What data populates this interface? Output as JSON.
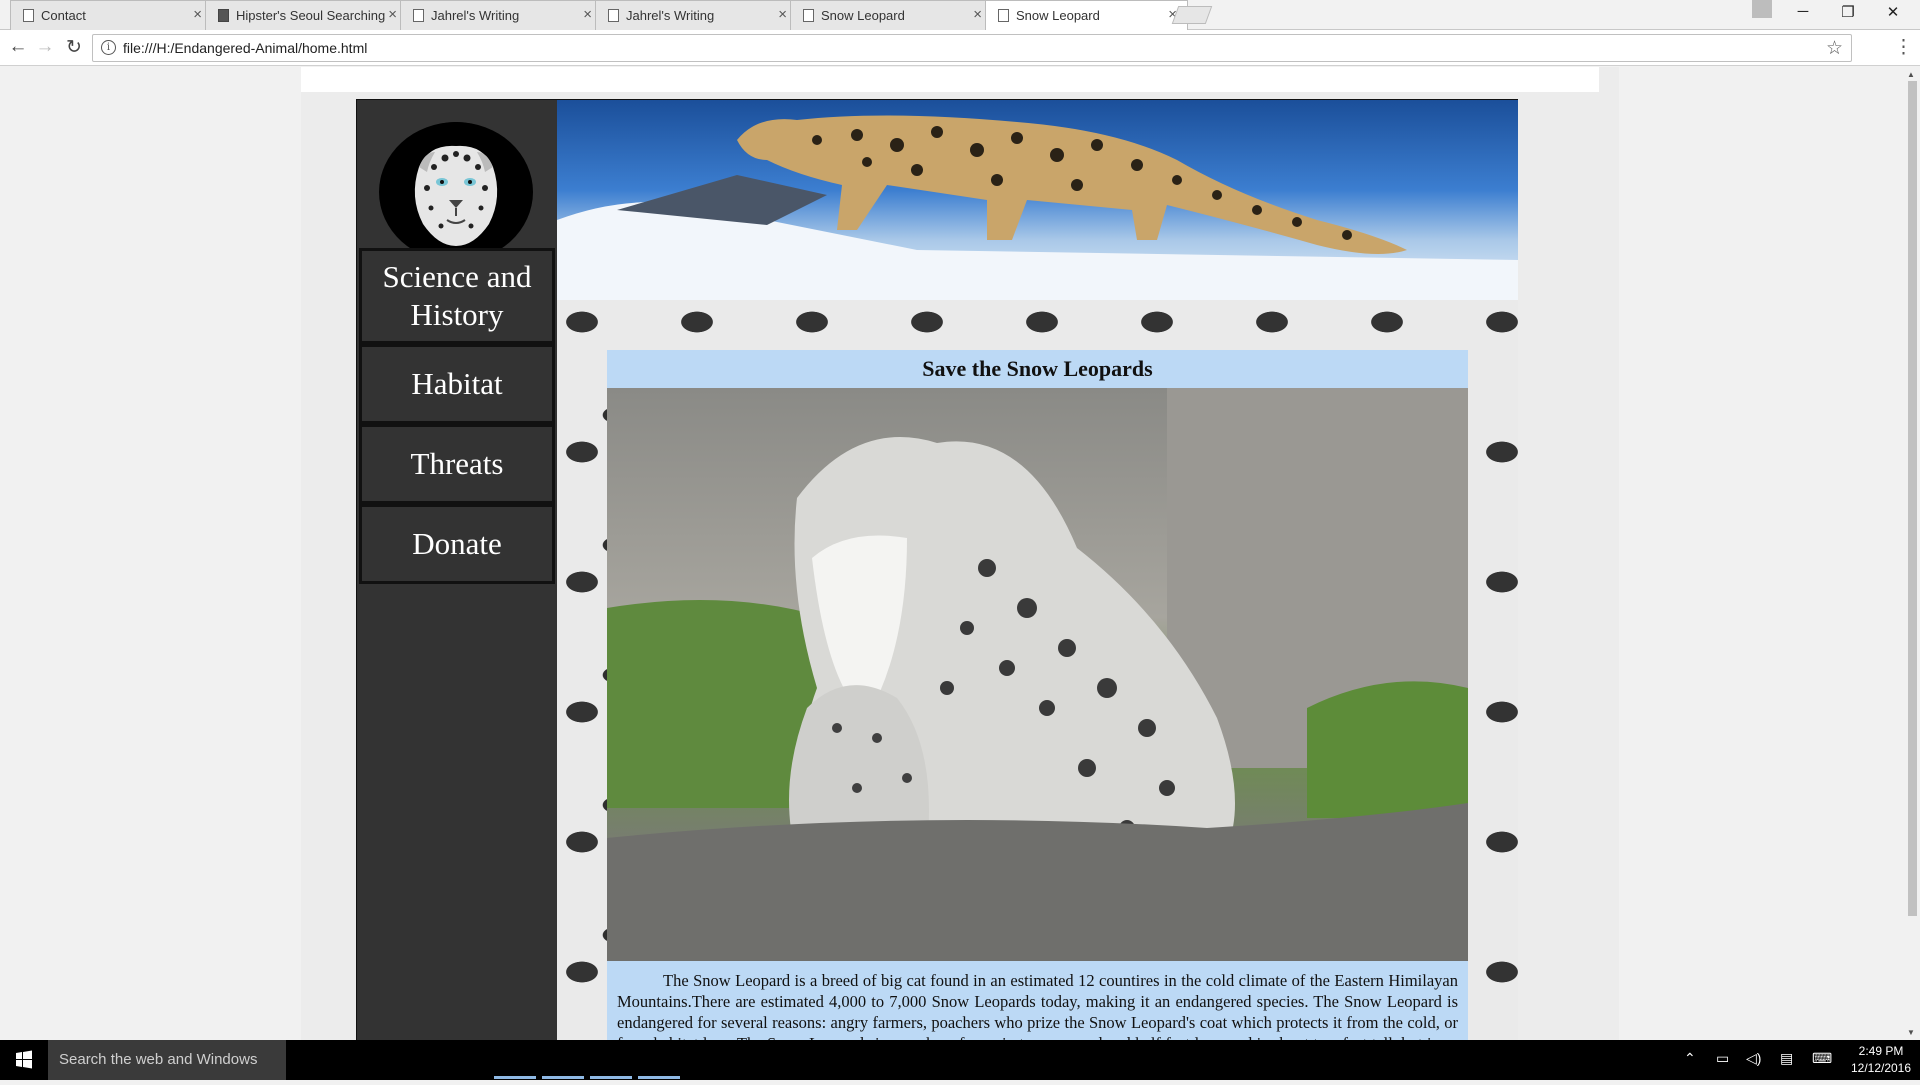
{
  "browser": {
    "tabs": [
      {
        "title": "Contact",
        "favicon": "page-icon"
      },
      {
        "title": "Hipster's Seoul Searching",
        "favicon": "bookmark-icon"
      },
      {
        "title": "Jahrel's Writing",
        "favicon": "page-icon"
      },
      {
        "title": "Jahrel's Writing",
        "favicon": "page-icon"
      },
      {
        "title": "Snow Leopard",
        "favicon": "page-icon"
      },
      {
        "title": "Snow Leopard",
        "favicon": "page-icon",
        "active": true
      }
    ],
    "tab_close_glyph": "×",
    "address": "file:///H:/Endangered-Animal/home.html",
    "info_glyph": "i",
    "star_glyph": "☆",
    "menu_glyph": "⋮",
    "back_glyph": "←",
    "forward_glyph": "→",
    "reload_glyph": "↻",
    "minimize_glyph": "─",
    "restore_glyph": "❐",
    "close_glyph": "✕"
  },
  "site": {
    "nav": [
      {
        "label": "Science and History"
      },
      {
        "label": "Habitat"
      },
      {
        "label": "Threats"
      },
      {
        "label": "Donate"
      }
    ],
    "content": {
      "title": "Save the Snow Leopards",
      "body": "The Snow Leopard is a breed of big cat found in an estimated 12 countires in the cold climate of the Eastern Himilayan Mountains.There are estimated 4,000 to 7,000 Snow Leopards today, making it an endangered species. The Snow Leopard is endangered for several reasons: angry farmers, poachers who prize the Snow Leopard's coat which protects it from the cold, or from habitat loss. The Snow Leopards is anywhere from six to seven and and half feet long and is about two feet tall, but is an extemely powerful creature. It is a carnivor which hunts anything from small"
    },
    "colors": {
      "sidebar": "#333333",
      "content_bg": "#bcd9f5",
      "nav_text": "#ffffff"
    }
  },
  "taskbar": {
    "search_placeholder": "Search the web and Windows",
    "time": "2:49 PM",
    "date": "12/12/2016",
    "tray_icons": [
      "chevron-up-icon",
      "network-icon",
      "volume-icon",
      "notification-icon",
      "keyboard-icon"
    ]
  }
}
